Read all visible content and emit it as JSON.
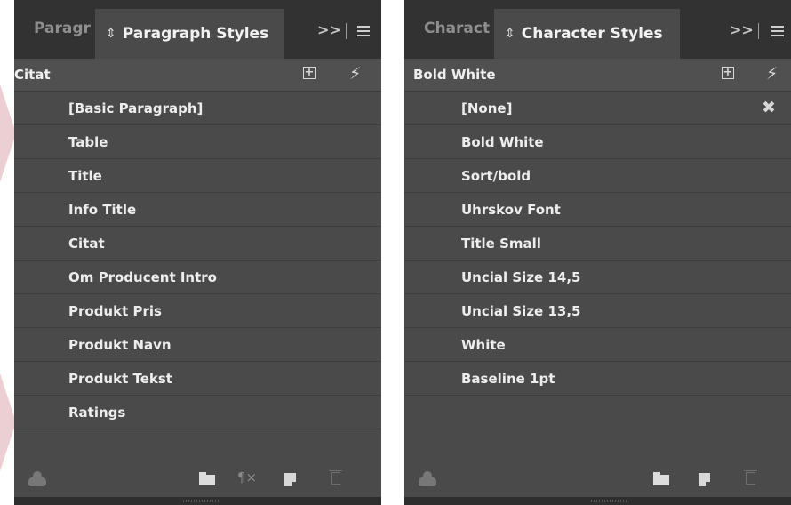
{
  "paragraph_panel": {
    "inactive_tab": "Paragr",
    "active_tab": "Paragraph Styles",
    "collapse_label": ">>",
    "current_style": "Citat",
    "styles": [
      "[Basic Paragraph]",
      "Table",
      "Title",
      "Info Title",
      "Citat",
      "Om Producent Intro",
      "Produkt Pris",
      "Produkt Navn",
      "Produkt Tekst",
      "Ratings"
    ],
    "footer_icons": [
      "cloud-icon",
      "folder-icon",
      "pilcrow-clear-icon",
      "new-style-icon",
      "trash-icon"
    ]
  },
  "character_panel": {
    "inactive_tab": "Charact",
    "active_tab": "Character Styles",
    "collapse_label": ">>",
    "current_style": "Bold White",
    "styles": [
      "[None]",
      "Bold White",
      "Sort/bold",
      "Uhrskov Font",
      "Title Small",
      "Uncial Size 14,5",
      "Uncial Size 13,5",
      "White",
      "Baseline 1pt"
    ],
    "footer_icons": [
      "cloud-icon",
      "folder-icon",
      "new-style-icon",
      "trash-icon"
    ]
  },
  "icons": {
    "sort": "⇕",
    "bolt": "⚡",
    "clear_override": "✖",
    "new_group": "+",
    "pilcrow": "¶×"
  },
  "colors": {
    "panel_bg": "#4a4a4a",
    "tab_bar": "#323232",
    "text": "#ededed"
  }
}
